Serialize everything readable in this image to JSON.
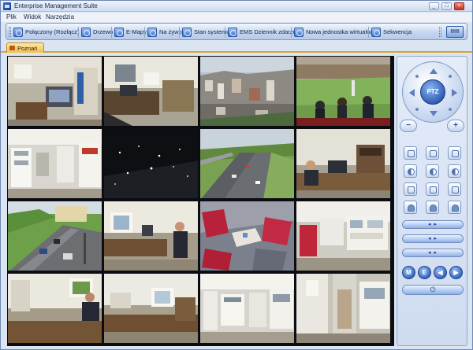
{
  "window": {
    "title": "Enterprise Management Suite",
    "controls": [
      "_",
      "□",
      "×"
    ]
  },
  "menu": {
    "items": [
      "Plik",
      "Widok",
      "Narzędzia"
    ]
  },
  "toolbar": {
    "buttons": [
      {
        "label": "Połączony (Rozłącz)",
        "icon": "connect-icon"
      },
      {
        "label": "Drzewo",
        "icon": "tree-icon"
      },
      {
        "label": "E-Mapy",
        "icon": "map-icon"
      },
      {
        "label": "Na żywo",
        "icon": "live-icon"
      },
      {
        "label": "Stan systemu",
        "icon": "status-icon"
      },
      {
        "label": "EMS Dziennik zdarzeń",
        "icon": "log-icon"
      },
      {
        "label": "Nowa jednostka wirtualna",
        "icon": "virtual-unit-icon"
      },
      {
        "label": "Sekwencja",
        "icon": "sequence-icon"
      }
    ],
    "right_button": "▤▤"
  },
  "tabs": [
    {
      "label": "Poznań",
      "icon": "camera-tab-icon"
    }
  ],
  "cameras": [
    {
      "id": 1,
      "scene": "office"
    },
    {
      "id": 2,
      "scene": "office-desk"
    },
    {
      "id": 3,
      "scene": "city"
    },
    {
      "id": 4,
      "scene": "outdoor-crowd"
    },
    {
      "id": 5,
      "scene": "store"
    },
    {
      "id": 6,
      "scene": "night"
    },
    {
      "id": 7,
      "scene": "highway"
    },
    {
      "id": 8,
      "scene": "office-person"
    },
    {
      "id": 9,
      "scene": "street"
    },
    {
      "id": 10,
      "scene": "office-person"
    },
    {
      "id": 11,
      "scene": "lounge-red"
    },
    {
      "id": 12,
      "scene": "store-red"
    },
    {
      "id": 13,
      "scene": "office-person"
    },
    {
      "id": 14,
      "scene": "office"
    },
    {
      "id": 15,
      "scene": "store"
    },
    {
      "id": 16,
      "scene": "room"
    }
  ],
  "ptz": {
    "center_label": "PTZ",
    "zoom_out": "−",
    "zoom_in": "+",
    "bar_buttons": [
      "◂ ▸",
      "◂ ▸",
      "◂ ▸"
    ],
    "media_buttons": [
      "M",
      "E",
      "◀",
      "▶"
    ],
    "power": "⏻",
    "colors": {
      "accent": "#2e5fb6",
      "tab": "#f2bf4e"
    }
  }
}
